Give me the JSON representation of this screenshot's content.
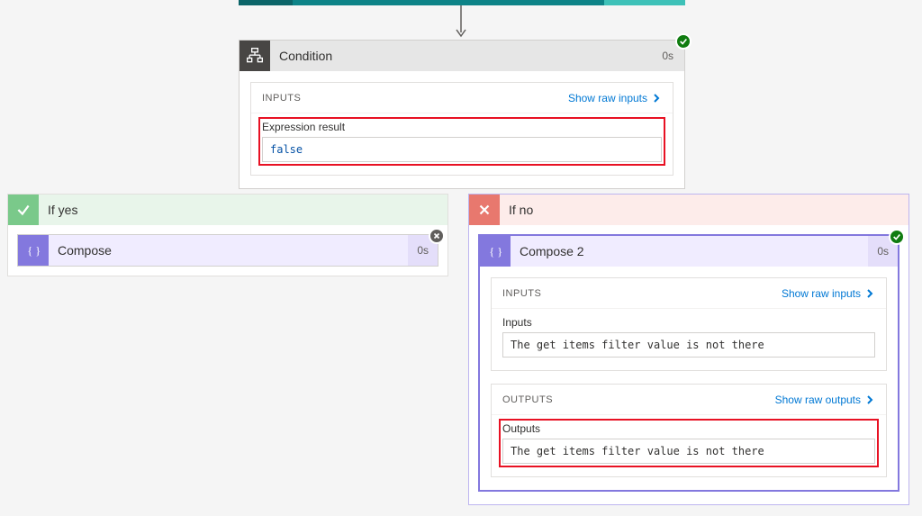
{
  "condition": {
    "title": "Condition",
    "duration": "0s",
    "inputs_label": "INPUTS",
    "show_raw_inputs": "Show raw inputs",
    "expression_result_label": "Expression result",
    "expression_result_value": "false"
  },
  "branch_yes": {
    "label": "If yes",
    "compose": {
      "title": "Compose",
      "duration": "0s"
    }
  },
  "branch_no": {
    "label": "If no",
    "compose": {
      "title": "Compose 2",
      "duration": "0s",
      "inputs_label": "INPUTS",
      "show_raw_inputs": "Show raw inputs",
      "inputs_field_label": "Inputs",
      "inputs_value": "The get items filter value is not there",
      "outputs_label": "OUTPUTS",
      "show_raw_outputs": "Show raw outputs",
      "outputs_field_label": "Outputs",
      "outputs_value": "The get items filter value is not there"
    }
  },
  "colors": {
    "condition_icon_bg": "#484644",
    "compose_icon_bg": "#8378de",
    "yes_bg": "#e8f5ea",
    "no_bg": "#fdecea",
    "success": "#107c10",
    "link": "#0078d4",
    "highlight": "#e81123"
  }
}
